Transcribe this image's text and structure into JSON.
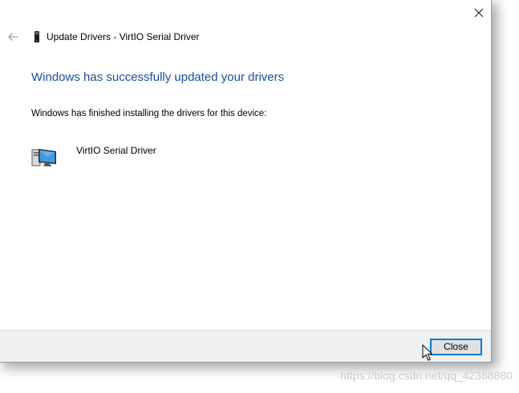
{
  "window": {
    "title": "Update Drivers - VirtIO Serial Driver"
  },
  "main": {
    "heading": "Windows has successfully updated your drivers",
    "message": "Windows has finished installing the drivers for this device:",
    "device": {
      "name": "VirtIO Serial Driver"
    }
  },
  "footer": {
    "close_label": "Close"
  },
  "watermark": {
    "text": "https://blog.csdn.net/qq_42388880"
  },
  "icons": {
    "back": "back-arrow-icon",
    "close": "close-icon",
    "title": "device-small-icon",
    "device": "computer-device-icon",
    "cursor": "mouse-cursor-icon"
  },
  "colors": {
    "heading": "#1a4ea1",
    "footer_bg": "#f0f0f0",
    "focus_border": "#0078d7",
    "back_arrow": "#a0a0a0",
    "device_screen": "#3c9be8"
  }
}
